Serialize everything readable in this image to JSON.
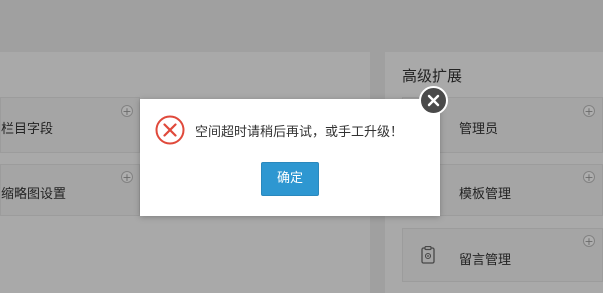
{
  "left_panel": {
    "tiles": [
      {
        "label": "栏目字段",
        "plus": "+"
      },
      {
        "label": "缩略图设置",
        "plus": "+"
      }
    ]
  },
  "right_panel": {
    "title": "高级扩展",
    "tiles": [
      {
        "label": "管理员",
        "plus": "+"
      },
      {
        "label": "模板管理",
        "plus": "+"
      },
      {
        "label": "留言管理",
        "plus": "+",
        "icon": "clipboard-icon"
      }
    ]
  },
  "dialog": {
    "message": "空间超时请稍后再试，或手工升级！",
    "ok_label": "确定",
    "icon": "error-x-icon",
    "close_icon": "close-icon"
  },
  "colors": {
    "accent": "#2e97d1",
    "error": "#e0493b"
  }
}
